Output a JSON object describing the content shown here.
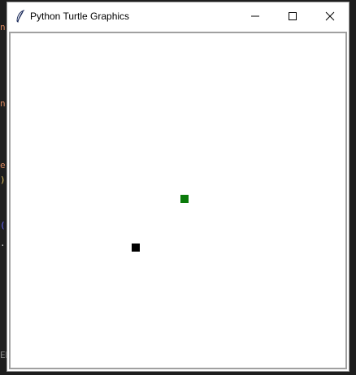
{
  "window": {
    "title": "Python Turtle Graphics",
    "icon": "feather-icon",
    "controls": {
      "minimize_icon": "minimize-icon",
      "maximize_icon": "maximize-icon",
      "close_icon": "close-icon"
    }
  },
  "background_code": {
    "fragments": [
      "n",
      "n",
      "e",
      ")",
      "(",
      ".",
      "ER"
    ]
  },
  "canvas": {
    "background": "#ffffff",
    "objects": [
      {
        "name": "food",
        "shape": "square",
        "color": "#0a7a0a"
      },
      {
        "name": "snake-head",
        "shape": "square",
        "color": "#000000"
      }
    ]
  }
}
